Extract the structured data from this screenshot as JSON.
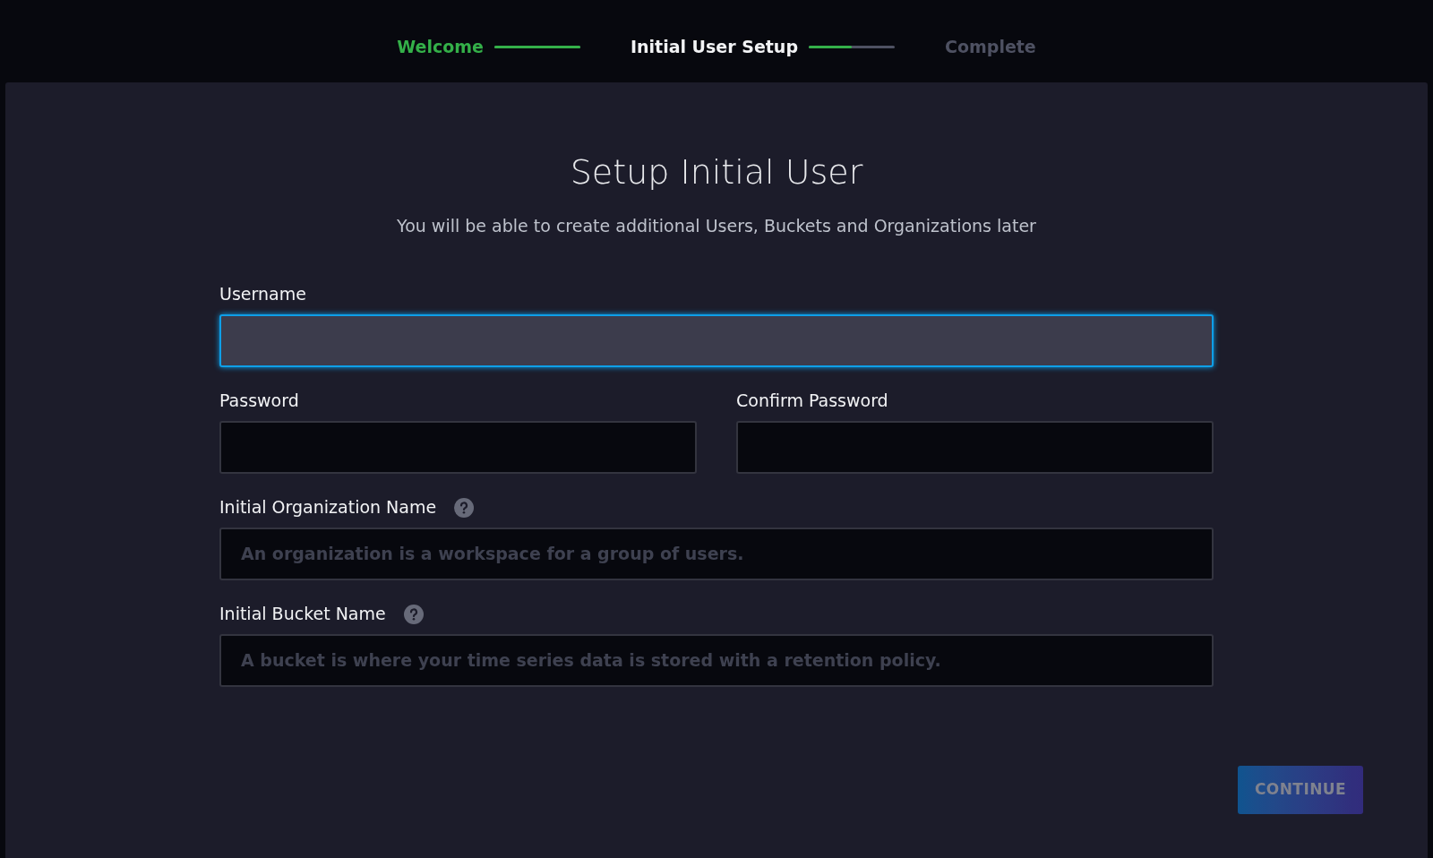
{
  "steps": [
    {
      "label": "Welcome",
      "kind": "complete",
      "level": 1
    },
    {
      "label": "Initial User Setup",
      "kind": "current",
      "level": 0.5
    },
    {
      "label": "Complete",
      "kind": "pending"
    }
  ],
  "form": {
    "title": "Setup Initial User",
    "subtitle": "You will be able to create additional Users, Buckets and Organizations later",
    "rows": [
      [
        {
          "label": "Username",
          "focused": true
        }
      ],
      [
        {
          "label": "Password",
          "focused": false
        },
        {
          "label": "Confirm Password",
          "focused": false
        }
      ],
      [
        {
          "label": "Initial Organization Name",
          "focused": false,
          "help": true,
          "placeholder": "An organization is a workspace for a group of users."
        }
      ],
      [
        {
          "label": "Initial Bucket Name",
          "focused": false,
          "help": true,
          "placeholder": "A bucket is where your time series data is stored with a retention policy."
        }
      ]
    ]
  },
  "continue_button": {
    "label": "CONTINUE",
    "disabled": true
  }
}
